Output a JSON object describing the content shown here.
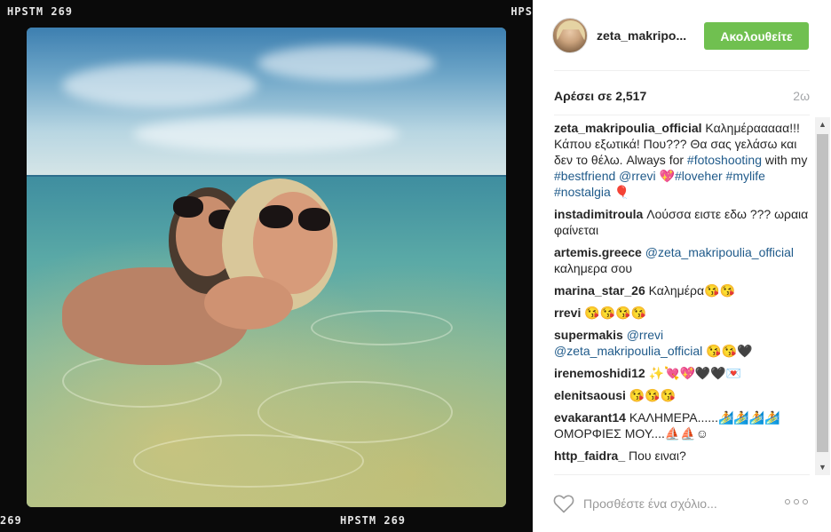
{
  "photo": {
    "film_top_left": "HPSTM 269",
    "film_top_right": "HPS",
    "film_bottom_left": "269",
    "film_bottom_center": "HPSTM 269"
  },
  "post": {
    "username": "zeta_makripo...",
    "follow_label": "Ακολουθείτε",
    "likes": "Αρέσει σε 2,517",
    "time_ago": "2ω"
  },
  "comments": [
    {
      "user": "zeta_makripoulia_official",
      "parts": [
        {
          "t": "text",
          "v": " Καλημέρααααα!!! Κάπου εξωτικά! Που??? Θα σας γελάσω και δεν το θέλω. Always for "
        },
        {
          "t": "link",
          "v": "#fotoshooting"
        },
        {
          "t": "text",
          "v": " with my "
        },
        {
          "t": "link",
          "v": "#bestfriend"
        },
        {
          "t": "text",
          "v": " "
        },
        {
          "t": "link",
          "v": "@rrevi"
        },
        {
          "t": "text",
          "v": " 💖"
        },
        {
          "t": "link",
          "v": "#loveher"
        },
        {
          "t": "text",
          "v": " "
        },
        {
          "t": "link",
          "v": "#mylife"
        },
        {
          "t": "text",
          "v": " "
        },
        {
          "t": "link",
          "v": "#nostalgia"
        },
        {
          "t": "text",
          "v": " 🎈"
        }
      ]
    },
    {
      "user": "instadimitroula",
      "parts": [
        {
          "t": "text",
          "v": " Λούσσα ειστε εδω ??? ωραια φαίνεται"
        }
      ]
    },
    {
      "user": "artemis.greece",
      "parts": [
        {
          "t": "text",
          "v": " "
        },
        {
          "t": "link",
          "v": "@zeta_makripoulia_official"
        },
        {
          "t": "text",
          "v": " καλημερα σου"
        }
      ]
    },
    {
      "user": "marina_star_26",
      "parts": [
        {
          "t": "text",
          "v": " Καλημέρα😘😘"
        }
      ]
    },
    {
      "user": "rrevi",
      "parts": [
        {
          "t": "text",
          "v": " 😘😘😘😘"
        }
      ]
    },
    {
      "user": "supermakis",
      "parts": [
        {
          "t": "text",
          "v": " "
        },
        {
          "t": "link",
          "v": "@rrevi"
        },
        {
          "t": "text",
          "v": " "
        },
        {
          "t": "link",
          "v": "@zeta_makripoulia_official"
        },
        {
          "t": "text",
          "v": " 😘😘🖤"
        }
      ]
    },
    {
      "user": "irenemoshidi12",
      "parts": [
        {
          "t": "text",
          "v": " ✨💘💖🖤🖤💌"
        }
      ]
    },
    {
      "user": "elenitsaousi",
      "parts": [
        {
          "t": "text",
          "v": " 😘😘😘"
        }
      ]
    },
    {
      "user": "evakarant14",
      "parts": [
        {
          "t": "text",
          "v": " ΚΑΛΗΜΕΡΑ......🏄🏄🏄🏄 ΟΜΟΡΦΙΕΣ ΜΟΥ....⛵⛵☺"
        }
      ]
    },
    {
      "user": "http_faidra_",
      "parts": [
        {
          "t": "text",
          "v": " Που ειναι?"
        }
      ]
    }
  ],
  "footer": {
    "comment_placeholder": "Προσθέστε ένα σχόλιο...",
    "heart_icon": "heart-outline-icon",
    "more_icon": "more-options-icon"
  },
  "scrollbar": {
    "up_glyph": "▲",
    "down_glyph": "▼"
  }
}
